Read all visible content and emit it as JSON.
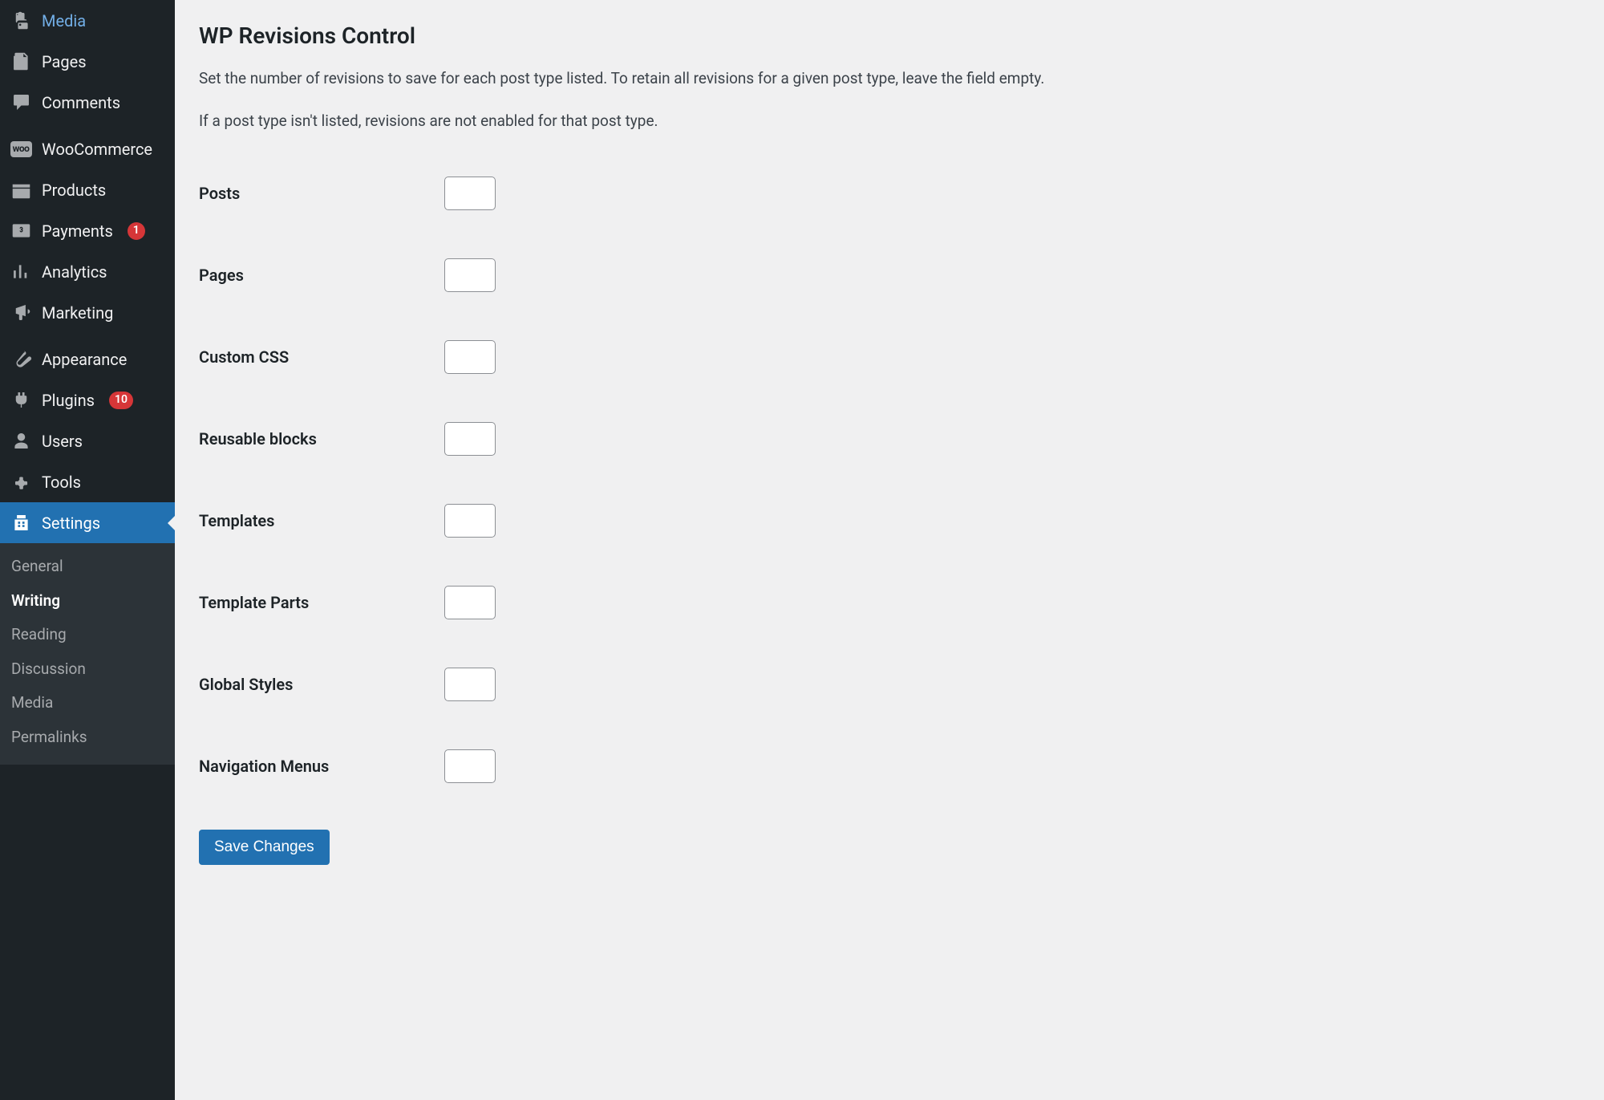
{
  "sidebar": {
    "items": [
      {
        "id": "media",
        "label": "Media",
        "icon": "media-icon"
      },
      {
        "id": "pages",
        "label": "Pages",
        "icon": "pages-icon"
      },
      {
        "id": "comments",
        "label": "Comments",
        "icon": "comments-icon"
      },
      {
        "id": "woocommerce",
        "label": "WooCommerce",
        "icon": "woocommerce-icon"
      },
      {
        "id": "products",
        "label": "Products",
        "icon": "products-icon"
      },
      {
        "id": "payments",
        "label": "Payments",
        "icon": "payments-icon",
        "badge": "1"
      },
      {
        "id": "analytics",
        "label": "Analytics",
        "icon": "analytics-icon"
      },
      {
        "id": "marketing",
        "label": "Marketing",
        "icon": "marketing-icon"
      },
      {
        "id": "appearance",
        "label": "Appearance",
        "icon": "appearance-icon"
      },
      {
        "id": "plugins",
        "label": "Plugins",
        "icon": "plugins-icon",
        "badge": "10"
      },
      {
        "id": "users",
        "label": "Users",
        "icon": "users-icon"
      },
      {
        "id": "tools",
        "label": "Tools",
        "icon": "tools-icon"
      },
      {
        "id": "settings",
        "label": "Settings",
        "icon": "settings-icon",
        "active": true
      }
    ],
    "submenu": {
      "parent": "settings",
      "items": [
        {
          "label": "General"
        },
        {
          "label": "Writing",
          "current": true
        },
        {
          "label": "Reading"
        },
        {
          "label": "Discussion"
        },
        {
          "label": "Media"
        },
        {
          "label": "Permalinks"
        }
      ]
    }
  },
  "main": {
    "heading": "WP Revisions Control",
    "description1": "Set the number of revisions to save for each post type listed. To retain all revisions for a given post type, leave the field empty.",
    "description2": "If a post type isn't listed, revisions are not enabled for that post type.",
    "fields": [
      {
        "label": "Posts",
        "value": ""
      },
      {
        "label": "Pages",
        "value": ""
      },
      {
        "label": "Custom CSS",
        "value": ""
      },
      {
        "label": "Reusable blocks",
        "value": ""
      },
      {
        "label": "Templates",
        "value": ""
      },
      {
        "label": "Template Parts",
        "value": ""
      },
      {
        "label": "Global Styles",
        "value": ""
      },
      {
        "label": "Navigation Menus",
        "value": ""
      }
    ],
    "save_label": "Save Changes"
  },
  "woo_text": "woo"
}
